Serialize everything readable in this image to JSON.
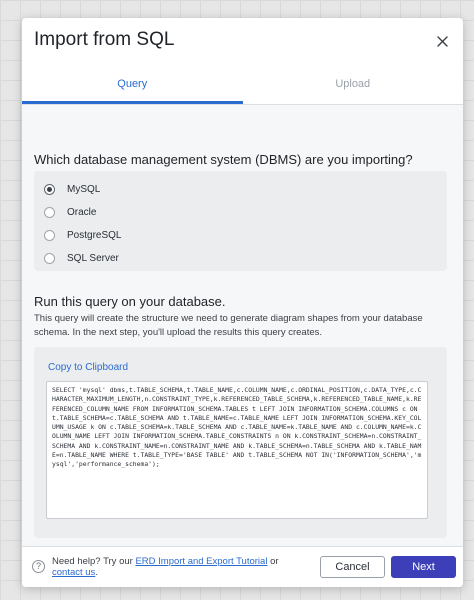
{
  "dialog": {
    "title": "Import from SQL",
    "close_icon": "close-icon"
  },
  "tabs": [
    {
      "label": "Query",
      "active": true
    },
    {
      "label": "Upload",
      "active": false
    }
  ],
  "dbms": {
    "question": "Which database management system (DBMS) are you importing?",
    "options": [
      {
        "label": "MySQL",
        "selected": true
      },
      {
        "label": "Oracle",
        "selected": false
      },
      {
        "label": "PostgreSQL",
        "selected": false
      },
      {
        "label": "SQL Server",
        "selected": false
      }
    ]
  },
  "query": {
    "heading": "Run this query on your database.",
    "description": "This query will create the structure we need to generate diagram shapes from your database schema. In the next step, you'll upload the results this query creates.",
    "copy_label": "Copy to Clipboard",
    "sql": "SELECT 'mysql' dbms,t.TABLE_SCHEMA,t.TABLE_NAME,c.COLUMN_NAME,c.ORDINAL_POSITION,c.DATA_TYPE,c.CHARACTER_MAXIMUM_LENGTH,n.CONSTRAINT_TYPE,k.REFERENCED_TABLE_SCHEMA,k.REFERENCED_TABLE_NAME,k.REFERENCED_COLUMN_NAME FROM INFORMATION_SCHEMA.TABLES t LEFT JOIN INFORMATION_SCHEMA.COLUMNS c ON t.TABLE_SCHEMA=c.TABLE_SCHEMA AND t.TABLE_NAME=c.TABLE_NAME LEFT JOIN INFORMATION_SCHEMA.KEY_COLUMN_USAGE k ON c.TABLE_SCHEMA=k.TABLE_SCHEMA AND c.TABLE_NAME=k.TABLE_NAME AND c.COLUMN_NAME=k.COLUMN_NAME LEFT JOIN INFORMATION_SCHEMA.TABLE_CONSTRAINTS n ON k.CONSTRAINT_SCHEMA=n.CONSTRAINT_SCHEMA AND k.CONSTRAINT_NAME=n.CONSTRAINT_NAME AND k.TABLE_SCHEMA=n.TABLE_SCHEMA AND k.TABLE_NAME=n.TABLE_NAME WHERE t.TABLE_TYPE='BASE TABLE' AND t.TABLE_SCHEMA NOT IN('INFORMATION_SCHEMA','mysql','performance_schema');"
  },
  "footer": {
    "help_icon": "question-circle-icon",
    "help_prefix": "Need help? Try our ",
    "help_link": "ERD Import and Export Tutorial",
    "help_middle": " or ",
    "contact_link": "contact us",
    "help_suffix": ".",
    "cancel_label": "Cancel",
    "next_label": "Next"
  },
  "colors": {
    "accent": "#2a6bd1",
    "primary_button": "#3d3fb8"
  }
}
